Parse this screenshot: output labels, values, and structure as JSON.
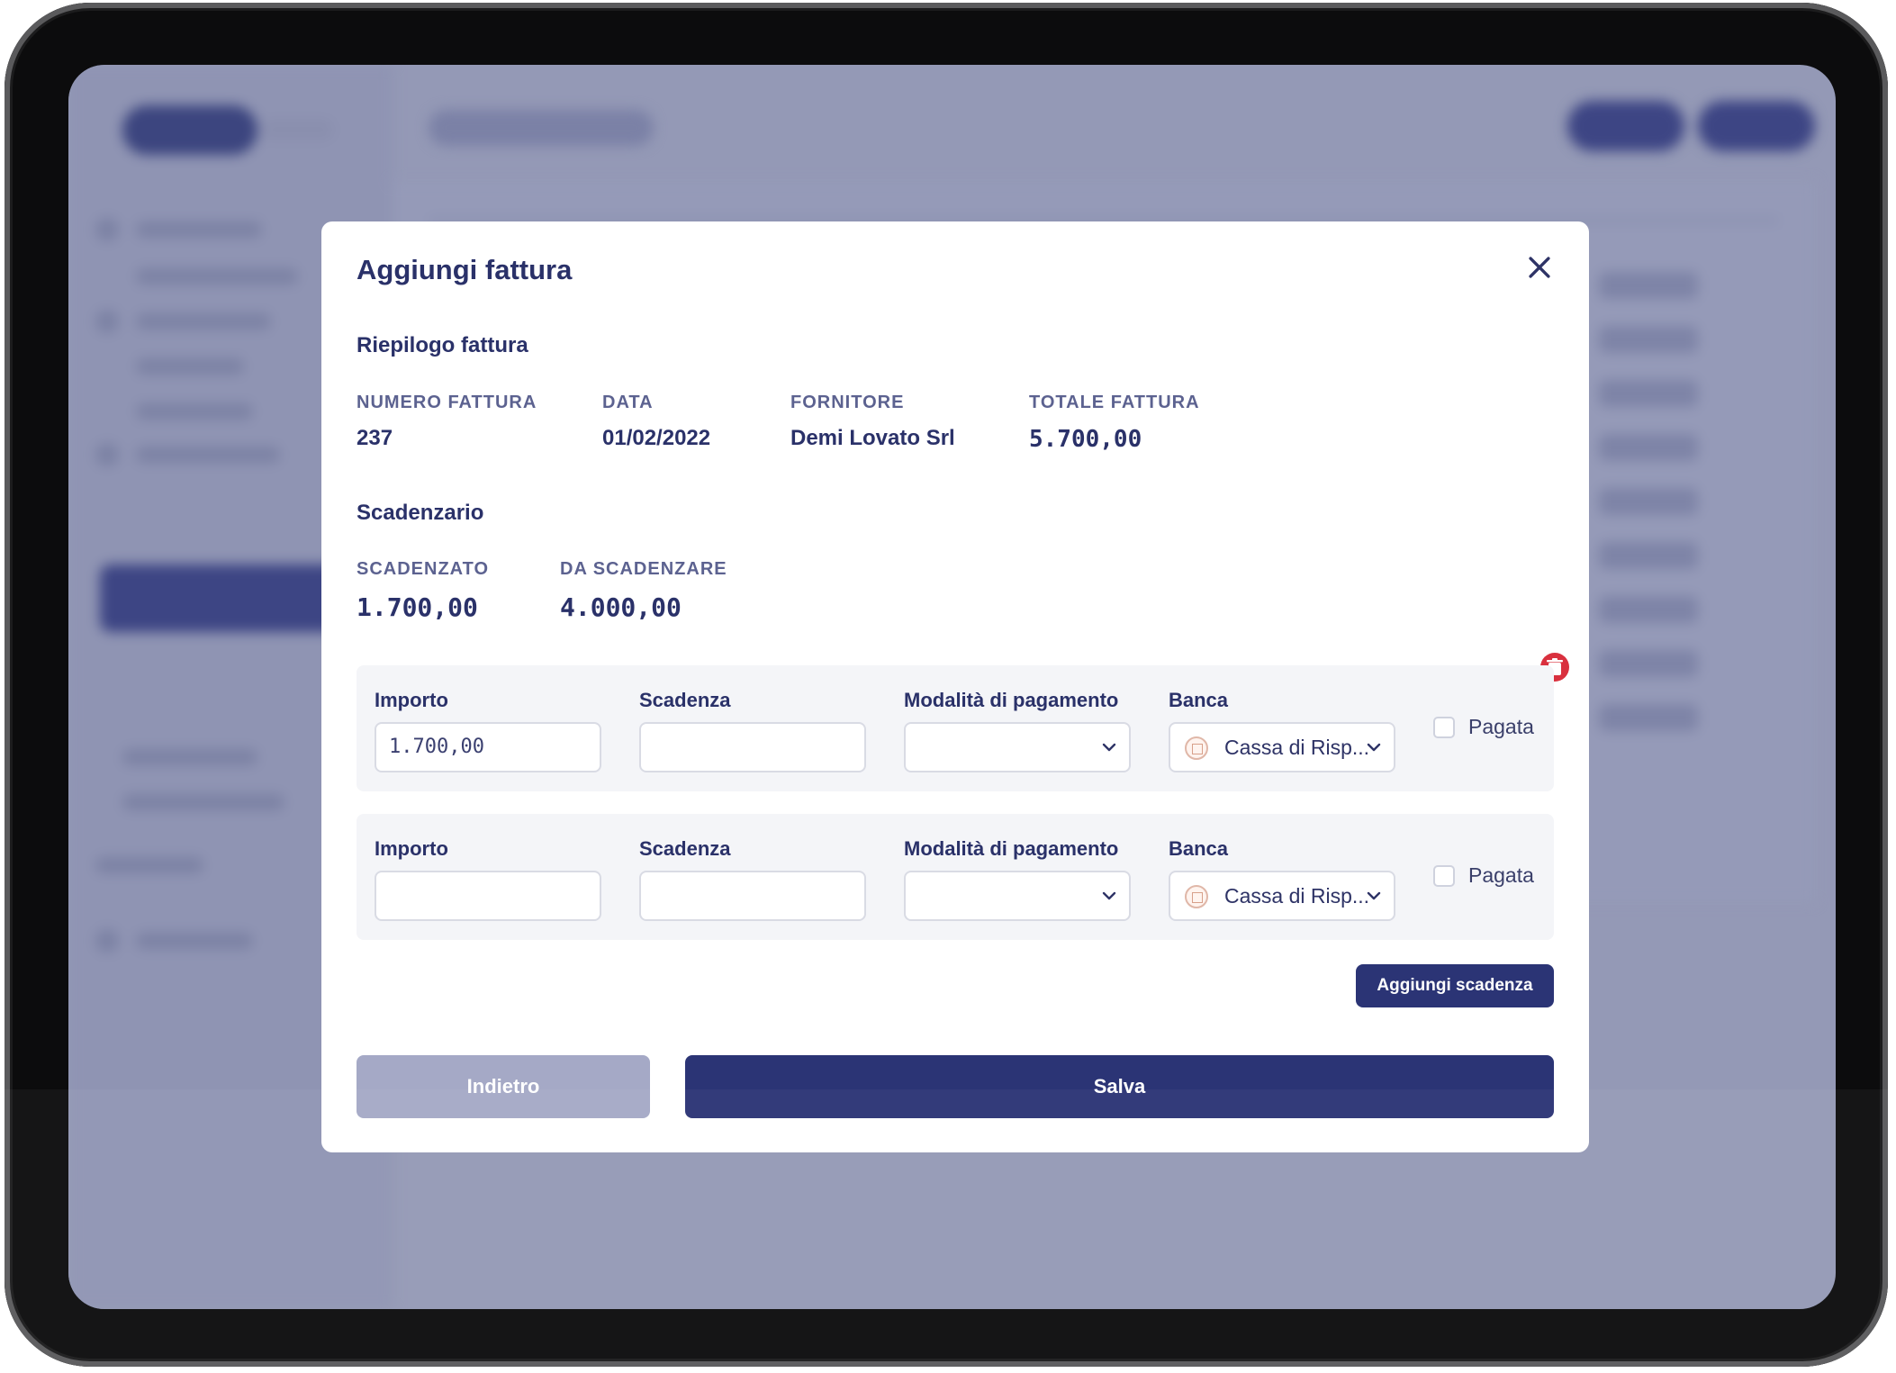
{
  "modal": {
    "title": "Aggiungi fattura",
    "summary": {
      "section_title": "Riepilogo fattura",
      "fields": [
        {
          "label": "NUMERO FATTURA",
          "value": "237"
        },
        {
          "label": "DATA",
          "value": "01/02/2022"
        },
        {
          "label": "FORNITORE",
          "value": "Demi Lovato Srl"
        },
        {
          "label": "TOTALE FATTURA",
          "value": "5.700,00"
        }
      ]
    },
    "schedule": {
      "section_title": "Scadenzario",
      "fields": [
        {
          "label": "SCADENZATO",
          "value": "1.700,00"
        },
        {
          "label": "DA SCADENZARE",
          "value": "4.000,00"
        }
      ]
    },
    "rows": [
      {
        "importo_label": "Importo",
        "importo_value": "1.700,00",
        "scadenza_label": "Scadenza",
        "scadenza_value": "",
        "modalita_label": "Modalità di pagamento",
        "modalita_value": "",
        "banca_label": "Banca",
        "banca_value": "Cassa di Risp...",
        "pagata_label": "Pagata",
        "pagata_checked": false
      },
      {
        "importo_label": "Importo",
        "importo_value": "",
        "scadenza_label": "Scadenza",
        "scadenza_value": "",
        "modalita_label": "Modalità di pagamento",
        "modalita_value": "",
        "banca_label": "Banca",
        "banca_value": "Cassa di Risp...",
        "pagata_label": "Pagata",
        "pagata_checked": false
      }
    ],
    "add_deadline_label": "Aggiungi scadenza",
    "back_label": "Indietro",
    "save_label": "Salva"
  },
  "colors": {
    "primary": "#2b3475",
    "overlay": "#9499b6",
    "delete": "#d9303e",
    "disabled_button": "#a5a9c6"
  },
  "icons": {
    "close": "close-icon",
    "delete": "trash-icon",
    "dropdown": "chevron-down-icon",
    "bank": "bank-logo-icon"
  }
}
